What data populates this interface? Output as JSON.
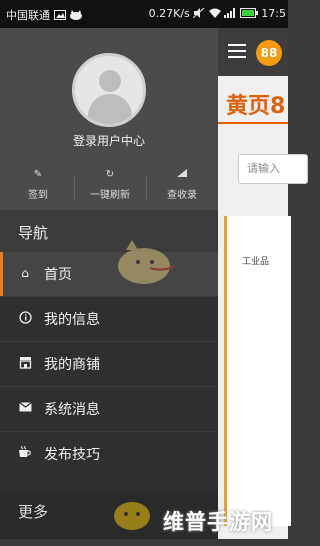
{
  "status_bar": {
    "carrier": "中国联通",
    "speed": "0.27K/s",
    "time": "17:5"
  },
  "app": {
    "logo_text": "88",
    "title": "黄页8",
    "search_placeholder": "请输入",
    "category": "工业品"
  },
  "drawer": {
    "profile": {
      "login_label": "登录用户中心"
    },
    "actions": [
      {
        "label": "签到",
        "icon": "pencil-icon"
      },
      {
        "label": "一键刷新",
        "icon": "refresh-icon"
      },
      {
        "label": "查收录",
        "icon": "signal-icon"
      }
    ],
    "nav_header": "导航",
    "menu": [
      {
        "label": "首页",
        "icon": "home-icon",
        "active": true
      },
      {
        "label": "我的信息",
        "icon": "info-icon"
      },
      {
        "label": "我的商铺",
        "icon": "store-icon"
      },
      {
        "label": "系统消息",
        "icon": "mail-icon"
      },
      {
        "label": "发布技巧",
        "icon": "cup-icon"
      }
    ],
    "more_label": "更多"
  },
  "watermark": "维普手游网",
  "colors": {
    "accent": "#e67e22",
    "title": "#e0600b",
    "drawer_bg": "#2f2f2f"
  }
}
